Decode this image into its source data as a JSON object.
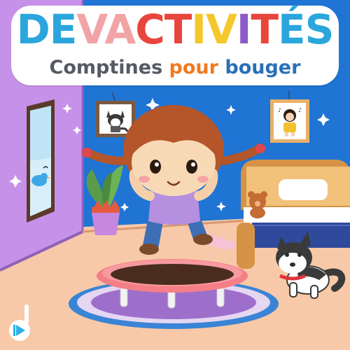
{
  "title": {
    "letters": [
      {
        "ch": "D",
        "color": "#2aa6dc"
      },
      {
        "ch": "E",
        "color": "#2aa6dc"
      },
      {
        "ch": "V",
        "color": "#f2a3a6"
      },
      {
        "ch": "A",
        "color": "#f2a3a6"
      },
      {
        "ch": "C",
        "color": "#e8453c"
      },
      {
        "ch": "T",
        "color": "#e8453c"
      },
      {
        "ch": "I",
        "color": "#f4c72a"
      },
      {
        "ch": "V",
        "color": "#f4c72a"
      },
      {
        "ch": "I",
        "color": "#8c5bc7"
      },
      {
        "ch": "T",
        "color": "#e8453c"
      },
      {
        "ch": "É",
        "color": "#2aa6dc"
      },
      {
        "ch": "S",
        "color": "#2aa6dc"
      }
    ]
  },
  "subtitle": {
    "word1": "Comptines",
    "word2": "pour",
    "word3": "bouger",
    "color1": "#555a63",
    "color2": "#f07b1f",
    "color3": "#2a6fb8"
  },
  "colors": {
    "back_wall": "#1f74d4",
    "side_wall": "#c691e8",
    "floor": "#f8c9a8",
    "rug": "#e5d6f2",
    "trampoline": "#f57f86"
  },
  "icons": {
    "brand": "play-logo-icon"
  }
}
